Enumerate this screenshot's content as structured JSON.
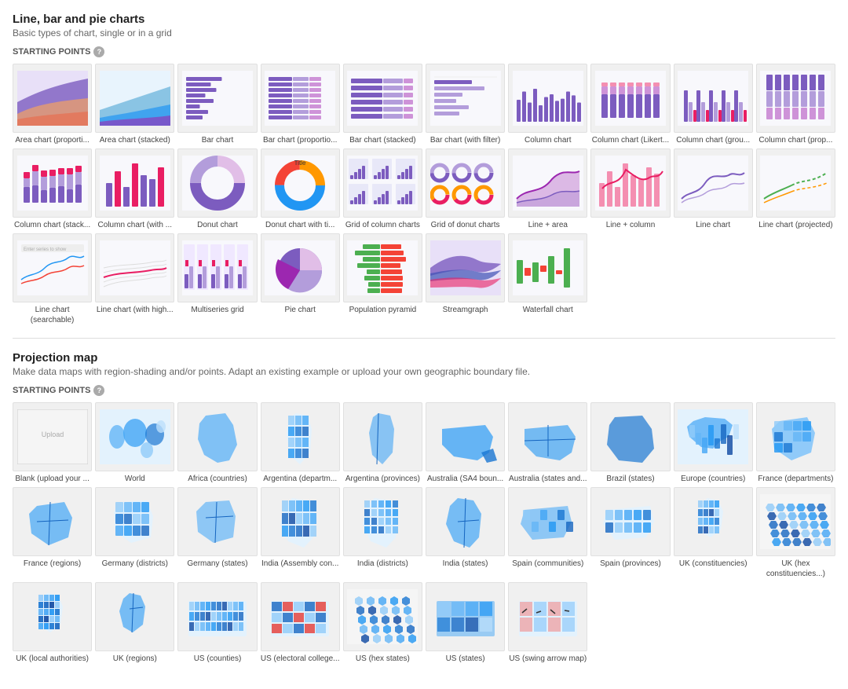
{
  "sections": [
    {
      "id": "line-bar-pie",
      "title": "Line, bar and pie charts",
      "subtitle": "Basic types of chart, single or in a grid",
      "starting_points_label": "STARTING POINTS",
      "charts": [
        {
          "id": "area-proportional",
          "label": "Area chart (proporti...",
          "type": "area-proportional"
        },
        {
          "id": "area-stacked",
          "label": "Area chart (stacked)",
          "type": "area-stacked"
        },
        {
          "id": "bar",
          "label": "Bar chart",
          "type": "bar"
        },
        {
          "id": "bar-proportional",
          "label": "Bar chart (proportio...",
          "type": "bar-proportional"
        },
        {
          "id": "bar-stacked",
          "label": "Bar chart (stacked)",
          "type": "bar-stacked"
        },
        {
          "id": "bar-filter",
          "label": "Bar chart (with filter)",
          "type": "bar-filter"
        },
        {
          "id": "column",
          "label": "Column chart",
          "type": "column"
        },
        {
          "id": "column-likert",
          "label": "Column chart (Likert...",
          "type": "column-likert"
        },
        {
          "id": "column-grouped",
          "label": "Column chart (grou...",
          "type": "column-grouped"
        },
        {
          "id": "column-proportional",
          "label": "Column chart (prop...",
          "type": "column-proportional"
        },
        {
          "id": "column-stacked",
          "label": "Column chart (stack...",
          "type": "column-stacked"
        },
        {
          "id": "column-with",
          "label": "Column chart (with ...",
          "type": "column-with"
        },
        {
          "id": "donut",
          "label": "Donut chart",
          "type": "donut"
        },
        {
          "id": "donut-title",
          "label": "Donut chart with ti...",
          "type": "donut-title"
        },
        {
          "id": "grid-column",
          "label": "Grid of column charts",
          "type": "grid-column"
        },
        {
          "id": "grid-donut",
          "label": "Grid of donut charts",
          "type": "grid-donut"
        },
        {
          "id": "line-area",
          "label": "Line + area",
          "type": "line-area"
        },
        {
          "id": "line-column",
          "label": "Line + column",
          "type": "line-column"
        },
        {
          "id": "line",
          "label": "Line chart",
          "type": "line"
        },
        {
          "id": "line-projected",
          "label": "Line chart (projected)",
          "type": "line-projected"
        },
        {
          "id": "line-searchable",
          "label": "Line chart (searchable)",
          "type": "line-searchable"
        },
        {
          "id": "line-highlight",
          "label": "Line chart (with high...",
          "type": "line-highlight"
        },
        {
          "id": "multiseries",
          "label": "Multiseries grid",
          "type": "multiseries"
        },
        {
          "id": "pie",
          "label": "Pie chart",
          "type": "pie"
        },
        {
          "id": "population-pyramid",
          "label": "Population pyramid",
          "type": "population-pyramid"
        },
        {
          "id": "streamgraph",
          "label": "Streamgraph",
          "type": "streamgraph"
        },
        {
          "id": "waterfall",
          "label": "Waterfall chart",
          "type": "waterfall"
        }
      ]
    },
    {
      "id": "projection-map",
      "title": "Projection map",
      "subtitle": "Make data maps with region-shading and/or points. Adapt an existing example or upload your own geographic boundary file.",
      "starting_points_label": "STARTING POINTS",
      "maps": [
        {
          "id": "blank",
          "label": "Blank (upload your ...",
          "type": "blank-map"
        },
        {
          "id": "world",
          "label": "World",
          "type": "world-map"
        },
        {
          "id": "africa",
          "label": "Africa (countries)",
          "type": "africa-map"
        },
        {
          "id": "argentina-dept",
          "label": "Argentina (departm...",
          "type": "argentina-dept-map"
        },
        {
          "id": "argentina-prov",
          "label": "Argentina (provinces)",
          "type": "argentina-prov-map"
        },
        {
          "id": "australia-sa4",
          "label": "Australia (SA4 boun...",
          "type": "australia-sa4-map"
        },
        {
          "id": "australia-states",
          "label": "Australia (states and...",
          "type": "australia-states-map"
        },
        {
          "id": "brazil",
          "label": "Brazil (states)",
          "type": "brazil-map"
        },
        {
          "id": "europe",
          "label": "Europe (countries)",
          "type": "europe-map"
        },
        {
          "id": "france-dept",
          "label": "France (departments)",
          "type": "france-dept-map"
        },
        {
          "id": "france-regions",
          "label": "France (regions)",
          "type": "france-regions-map"
        },
        {
          "id": "germany-districts",
          "label": "Germany (districts)",
          "type": "germany-districts-map"
        },
        {
          "id": "germany-states",
          "label": "Germany (states)",
          "type": "germany-states-map"
        },
        {
          "id": "india-assembly",
          "label": "India (Assembly con...",
          "type": "india-assembly-map"
        },
        {
          "id": "india-districts",
          "label": "India (districts)",
          "type": "india-districts-map"
        },
        {
          "id": "india-states",
          "label": "India (states)",
          "type": "india-states-map"
        },
        {
          "id": "spain-communities",
          "label": "Spain (communities)",
          "type": "spain-communities-map"
        },
        {
          "id": "spain-provinces",
          "label": "Spain (provinces)",
          "type": "spain-provinces-map"
        },
        {
          "id": "uk-constituencies",
          "label": "UK (constituencies)",
          "type": "uk-const-map"
        },
        {
          "id": "uk-hex-const",
          "label": "UK (hex constituencies...)",
          "type": "uk-hex-const-map"
        },
        {
          "id": "uk-local",
          "label": "UK (local authorities)",
          "type": "uk-local-map"
        },
        {
          "id": "uk-regions",
          "label": "UK (regions)",
          "type": "uk-regions-map"
        },
        {
          "id": "us-counties",
          "label": "US (counties)",
          "type": "us-counties-map"
        },
        {
          "id": "us-electoral",
          "label": "US (electoral college...",
          "type": "us-electoral-map"
        },
        {
          "id": "us-hex-states",
          "label": "US (hex states)",
          "type": "us-hex-map"
        },
        {
          "id": "us-states",
          "label": "US (states)",
          "type": "us-states-map"
        },
        {
          "id": "us-swing",
          "label": "US (swing arrow map)",
          "type": "us-swing-map"
        }
      ]
    }
  ]
}
